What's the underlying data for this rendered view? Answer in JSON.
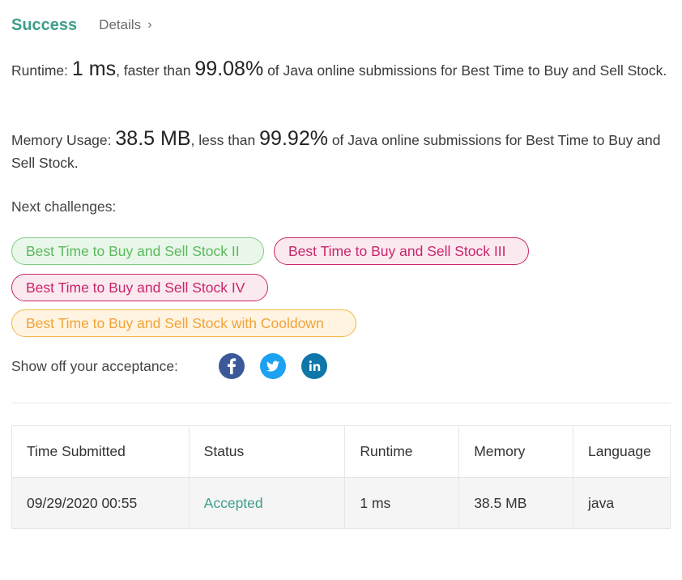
{
  "header": {
    "status": "Success",
    "details_label": "Details",
    "details_chevron": "›"
  },
  "runtime": {
    "label": "Runtime:",
    "value": "1 ms",
    "comparison": ", faster than",
    "percent": "99.08%",
    "suffix": "of Java online submissions for Best Time to Buy and Sell Stock."
  },
  "memory": {
    "label": "Memory Usage:",
    "value": "38.5 MB",
    "comparison": ", less than",
    "percent": "99.92%",
    "suffix": "of Java online submissions for Best Time to Buy and Sell Stock."
  },
  "next_challenges": {
    "label": "Next challenges:",
    "items": [
      {
        "label": "Best Time to Buy and Sell Stock II",
        "difficulty_color": "#5cb85c"
      },
      {
        "label": "Best Time to Buy and Sell Stock III",
        "difficulty_color": "#c8266b"
      },
      {
        "label": "Best Time to Buy and Sell Stock IV",
        "difficulty_color": "#c8266b"
      },
      {
        "label": "Best Time to Buy and Sell Stock with Cooldown",
        "difficulty_color": "#f0a33a"
      }
    ]
  },
  "share": {
    "label": "Show off your acceptance:",
    "icons": [
      "facebook-icon",
      "twitter-icon",
      "linkedin-icon"
    ]
  },
  "table": {
    "headers": [
      "Time Submitted",
      "Status",
      "Runtime",
      "Memory",
      "Language"
    ],
    "rows": [
      [
        "09/29/2020 00:55",
        "Accepted",
        "1 ms",
        "38.5 MB",
        "java"
      ]
    ]
  },
  "colors": {
    "success": "#3e9e8a",
    "facebook": "#3b5998",
    "twitter": "#1da1f2",
    "linkedin": "#0e76a8"
  }
}
